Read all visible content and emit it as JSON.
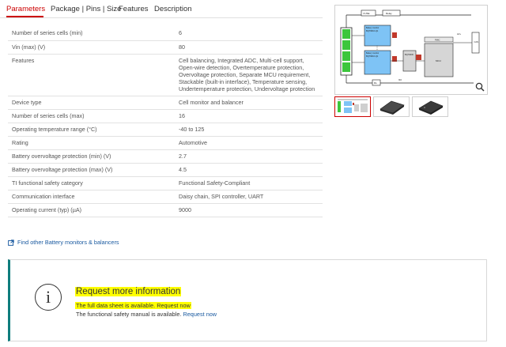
{
  "tabs": [
    "Parameters",
    "Package | Pins | Size",
    "Features",
    "Description"
  ],
  "params": [
    {
      "k": "Number of series cells (min)",
      "v": "6"
    },
    {
      "k": "Vin (max) (V)",
      "v": "80"
    },
    {
      "k": "Features",
      "v": "Cell balancing, Integrated ADC, Multi-cell support, Open-wire detection, Overtemperature protection, Overvoltage protection, Separate MCU requirement, Stackable (built-in interface), Temperature sensing, Undertemperature protection, Undervoltage protection"
    },
    {
      "k": "Device type",
      "v": "Cell monitor and balancer"
    },
    {
      "k": "Number of series cells (max)",
      "v": "16"
    },
    {
      "k": "Operating temperature range (°C)",
      "v": "-40 to 125"
    },
    {
      "k": "Rating",
      "v": "Automotive"
    },
    {
      "k": "Battery overvoltage protection (min) (V)",
      "v": "2.7"
    },
    {
      "k": "Battery overvoltage protection (max) (V)",
      "v": "4.5"
    },
    {
      "k": "TI functional safety category",
      "v": "Functional Safety-Compliant"
    },
    {
      "k": "Communication interface",
      "v": "Daisy chain, SPI controller, UART"
    },
    {
      "k": "Operating current (typ) (µA)",
      "v": "9000"
    }
  ],
  "find_link": "Find other Battery monitors & balancers",
  "info": {
    "title": "Request more information",
    "line1_text": "The full data sheet is available. ",
    "line1_link": "Request now",
    "line2_text": "The functional safety manual is available. ",
    "line2_link": "Request now"
  },
  "diagram": {
    "labels": {
      "fuse": "FUSE",
      "relay": "Relay",
      "dev_top": "BQ79616-Q1",
      "dev_top_sub": "Battery monitor",
      "dev_bot": "BQ79616-Q1",
      "dev_bot_sub": "Battery monitor",
      "bridge": "BQ79600",
      "mcu": "MCU",
      "pmic": "PMIC",
      "iso": "ISO",
      "can": "CAN",
      "hv": "HV+",
      "shunt": "Rs"
    }
  },
  "colors": {
    "accent": "#cc0000",
    "link": "#1a5aa0",
    "highlight": "#ffff00",
    "teal": "#0f7d7d"
  },
  "icons": {
    "find": "external-link-icon",
    "zoom": "magnifier-icon",
    "info": "info-circle-icon"
  }
}
